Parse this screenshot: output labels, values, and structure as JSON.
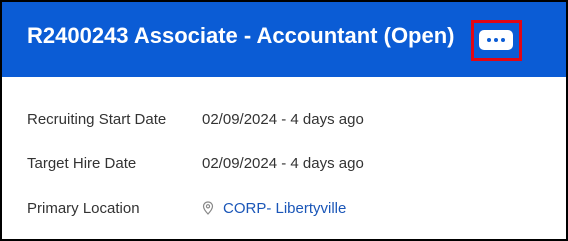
{
  "header": {
    "title": "R2400243 Associate - Accountant (Open)",
    "more_button_icon": "ellipsis-icon",
    "background_color": "#0b5cd5",
    "highlight_color": "#e30613"
  },
  "details": [
    {
      "label": "Recruiting Start Date",
      "value": "02/09/2024 - 4 days ago"
    },
    {
      "label": "Target Hire Date",
      "value": "02/09/2024 - 4 days ago"
    },
    {
      "label": "Primary Location",
      "value": "CORP- Libertyville",
      "icon": "location-pin-icon",
      "link_color": "#1a56b8"
    }
  ]
}
